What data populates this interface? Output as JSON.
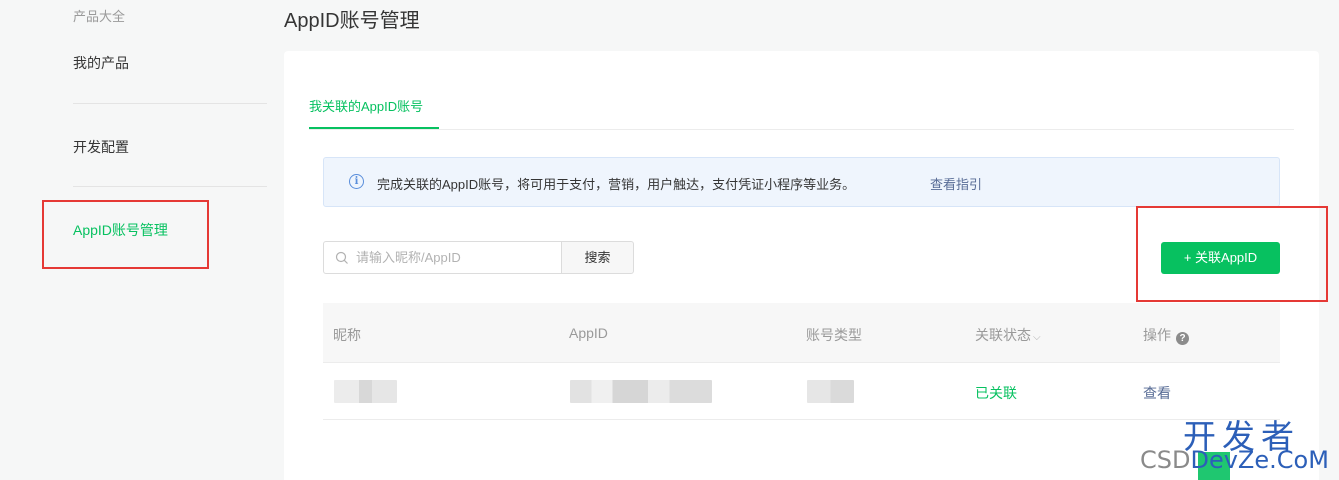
{
  "sidebar": {
    "items": [
      {
        "label": "产品大全"
      },
      {
        "label": "我的产品"
      },
      {
        "label": "开发配置"
      },
      {
        "label": "AppID账号管理"
      }
    ]
  },
  "header": {
    "title": "AppID账号管理"
  },
  "tabs": [
    {
      "label": "我关联的AppID账号",
      "active": true
    }
  ],
  "notice": {
    "text": "完成关联的AppID账号，将可用于支付，营销，用户触达，支付凭证小程序等业务。",
    "link": "查看指引"
  },
  "search": {
    "placeholder": "请输入昵称/AppID",
    "button": "搜索"
  },
  "actions": {
    "link_appid": "+ 关联AppID"
  },
  "table": {
    "columns": [
      "昵称",
      "AppID",
      "账号类型",
      "关联状态",
      "操作"
    ],
    "rows": [
      {
        "status": "已关联",
        "action": "查看"
      }
    ]
  },
  "watermark": {
    "line1": "开发者",
    "line2_prefix": "CSD",
    "line2_brand": "DevZe.CoM"
  },
  "colors": {
    "accent": "#07c160",
    "link": "#576b95",
    "annotation_red": "#e53935",
    "notice_bg": "#eff5fd"
  }
}
